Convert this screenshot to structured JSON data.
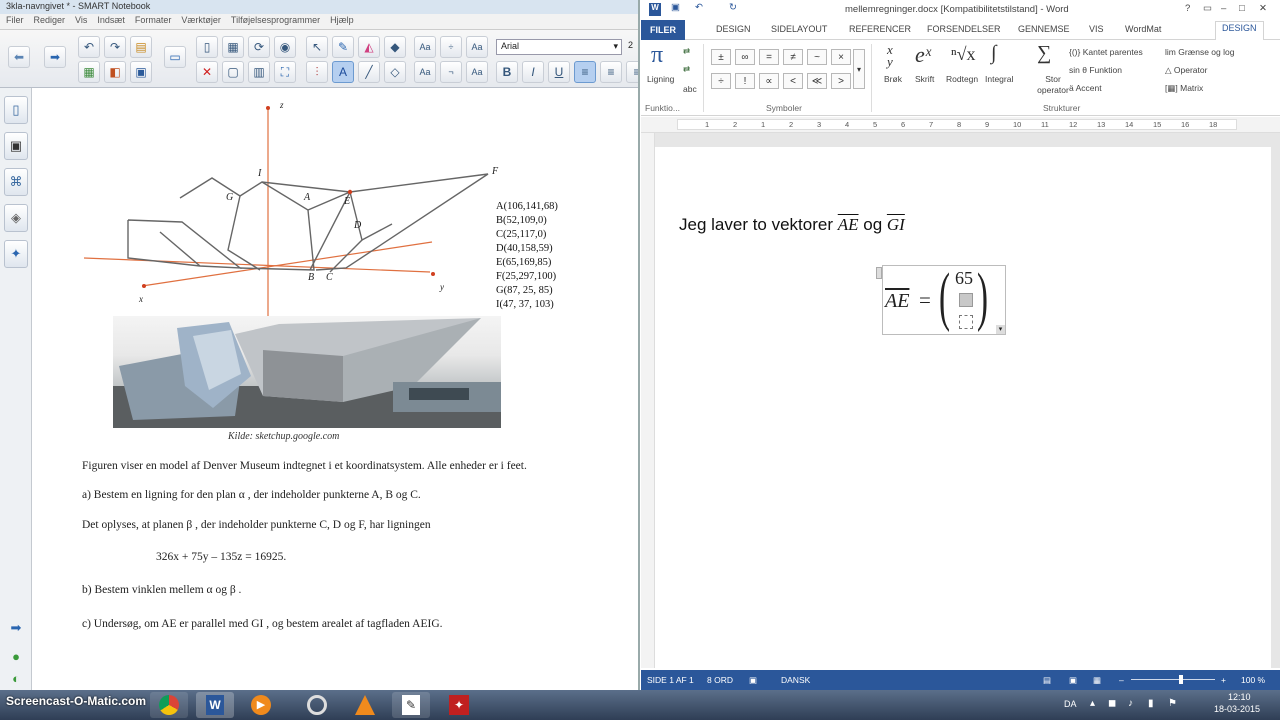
{
  "notebook": {
    "title": "3kla-navngivet * - SMART Notebook",
    "menu": [
      "Filer",
      "Rediger",
      "Vis",
      "Indsæt",
      "Formater",
      "Værktøjer",
      "Tilføjelsesprogrammer",
      "Hjælp"
    ],
    "font_name": "Arial",
    "font_size": "2",
    "figure": {
      "axis_labels": {
        "z": "z",
        "x": "x",
        "y": "y"
      },
      "point_labels": [
        "I",
        "G",
        "A",
        "E",
        "F",
        "D",
        "B",
        "C"
      ],
      "coordinates": [
        "A(106,141,68)",
        "B(52,109,0)",
        "C(25,117,0)",
        "D(40,158,59)",
        "E(65,169,85)",
        "F(25,297,100)",
        "G(87, 25, 85)",
        "I(47, 37, 103)"
      ],
      "photo_caption": "Kilde: sketchup.google.com"
    },
    "text": {
      "intro": "Figuren viser en model af Denver Museum indtegnet i et koordinatsystem. Alle enheder er i feet.",
      "a": "a)   Bestem en ligning for den plan  α , der indeholder punkterne A, B og C.",
      "info": "Det oplyses, at planen  β ,  der indeholder punkterne C, D og F, har ligningen",
      "equation": "326x  + 75y – 135z  =  16925.",
      "b": "b)   Bestem vinklen mellem  α  og  β .",
      "c": "c)   Undersøg, om  AE  er parallel med  GI , og bestem arealet af tagfladen AEIG."
    }
  },
  "word": {
    "title": "mellemregninger.docx [Kompatibilitetstilstand] - Word",
    "window_buttons": [
      "?",
      "▭",
      "–",
      "□",
      "✕"
    ],
    "tabs": [
      "FILER",
      "DESIGN",
      "SIDELAYOUT",
      "REFERENCER",
      "FORSENDELSER",
      "GENNEMSE",
      "VIS",
      "WordMat",
      "DESIGN"
    ],
    "ribbon": {
      "tools": {
        "ligning": "Ligning",
        "abc": "abc",
        "group": "Funktio..."
      },
      "symbols": [
        "±",
        "∞",
        "=",
        "≠",
        "~",
        "×",
        "÷",
        "!",
        "∝",
        "<",
        "≪",
        ">"
      ],
      "symbols_group": "Symboler",
      "structures": [
        "Brøk",
        "Skrift",
        "Rodtegn",
        "Integral",
        "Stor operator"
      ],
      "structures_extra": [
        "Kantet parentes",
        "Funktion",
        "Accent",
        "Grænse og log",
        "Operator",
        "Matrix"
      ],
      "structures_group": "Strukturer"
    },
    "ruler_numbers": [
      "1",
      "2",
      "1",
      "2",
      "3",
      "4",
      "5",
      "6",
      "7",
      "8",
      "9",
      "10",
      "11",
      "12",
      "13",
      "14",
      "15",
      "16",
      "18"
    ],
    "doc": {
      "sentence_prefix": "Jeg laver to vektorer ",
      "vec1": "AE",
      "conj": " og ",
      "vec2": "GI",
      "eq_lhs": "AE",
      "eq_sign": "=",
      "matrix_top": "65"
    },
    "status": {
      "page": "SIDE 1 AF 1",
      "words": "8 ORD",
      "lang": "DANSK",
      "zoom": "100 %"
    }
  },
  "taskbar": {
    "watermark": "Screencast-O-Matic.com",
    "tray": {
      "lang": "DA",
      "time": "12:10",
      "date": "18-03-2015"
    }
  },
  "colors": {
    "word_blue": "#2b579a",
    "orange_axis": "#e07040",
    "notebook_toolbar": "#e6e9ee"
  }
}
